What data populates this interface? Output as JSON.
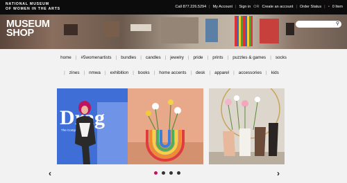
{
  "header": {
    "logo_line1": "NATIONAL MUSEUM",
    "logo_line2": "OF WOMEN IN THE ARTS",
    "phone": "Call 877.226.5294",
    "my_account": "My Account",
    "sign_in": "Sign in",
    "or": "OR",
    "create_account": "Create an account",
    "order_status": "Order Status",
    "cart": "0 Item"
  },
  "hero": {
    "title_line1": "MUSEUM",
    "title_line2": "SHOP",
    "search_placeholder": ""
  },
  "nav": {
    "row1": [
      "home",
      "#5womenartists",
      "bundles",
      "candles",
      "jewelry",
      "pride",
      "prints",
      "puzzles & games",
      "socks"
    ],
    "row2": [
      "zines",
      "nmwa",
      "exhibition",
      "books",
      "home accents",
      "desk",
      "apparel",
      "accessories",
      "kids"
    ]
  },
  "carousel": {
    "book_title": "Drag",
    "book_subtitle": "The Complete Story",
    "prev": "‹",
    "next": "›",
    "slide_count": 4,
    "active_slide": 1
  },
  "colors": {
    "active_dot": "#c0135d",
    "cart_icon": "#ee4444"
  }
}
